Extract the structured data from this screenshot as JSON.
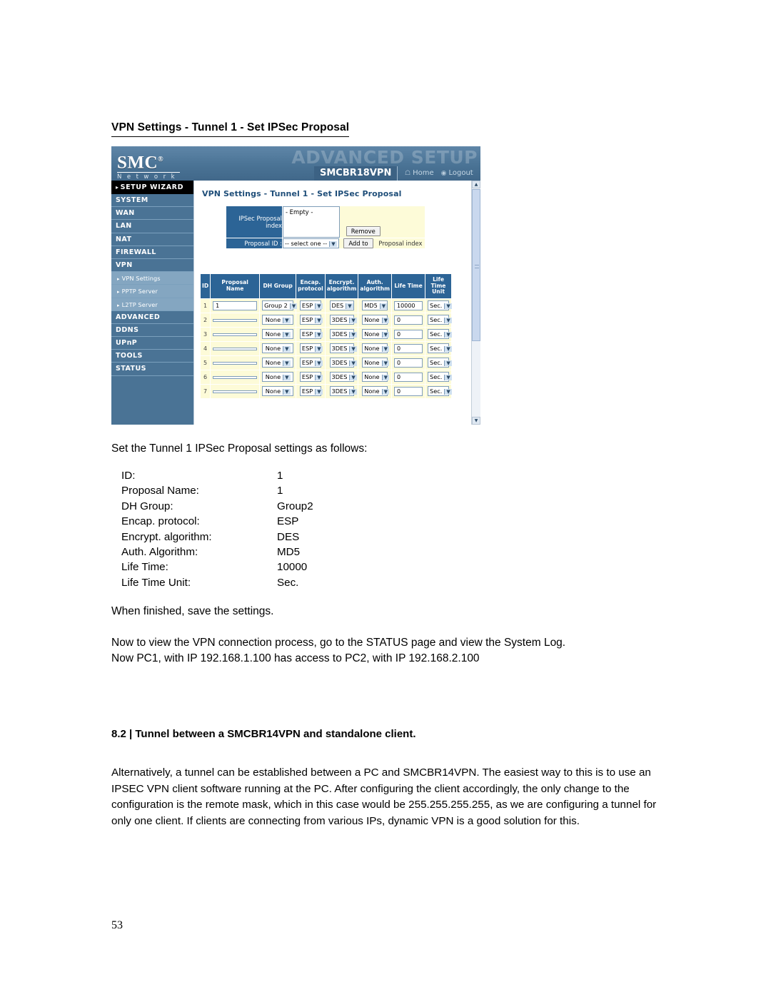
{
  "document": {
    "title": "VPN Settings - Tunnel 1 - Set IPSec Proposal",
    "intro": "Set the Tunnel 1 IPSec Proposal settings as follows:",
    "finish_note": "When finished, save the settings.",
    "status_note_line1": "Now to view the VPN connection process, go to the STATUS page and view the System Log.",
    "status_note_line2": "Now PC1, with IP 192.168.1.100 has access to PC2, with IP 192.168.2.100",
    "section_heading": "8.2 | Tunnel between a SMCBR14VPN and standalone client.",
    "section_paragraph": "Alternatively, a tunnel can be established between a PC and SMCBR14VPN. The easiest way to this is to use an IPSEC VPN client software running at the PC. After configuring the client accordingly, the only change to the configuration is the remote mask, which in this case would be 255.255.255.255, as we are configuring a tunnel for only one client. If clients are connecting from various IPs, dynamic VPN is a good solution for this.",
    "page_number": "53"
  },
  "settings_list": [
    {
      "key": "ID:",
      "value": "1"
    },
    {
      "key": "Proposal Name:",
      "value": "1"
    },
    {
      "key": "DH Group:",
      "value": "Group2"
    },
    {
      "key": "Encap. protocol:",
      "value": "ESP"
    },
    {
      "key": "Encrypt. algorithm:",
      "value": "DES"
    },
    {
      "key": "Auth. Algorithm:",
      "value": "MD5"
    },
    {
      "key": "Life Time:",
      "value": "10000"
    },
    {
      "key": "Life Time Unit:",
      "value": "Sec."
    }
  ],
  "router_ui": {
    "brand": "SMC",
    "brand_reg": "®",
    "brand_sub": "N e t w o r k s",
    "watermark": "ADVANCED SETUP",
    "model": "SMCBR18VPN",
    "top_nav": [
      {
        "label": "Home",
        "icon": "home-icon"
      },
      {
        "label": "Logout",
        "icon": "logout-icon"
      }
    ],
    "wizard_label": "SETUP WIZARD",
    "sidebar": [
      {
        "label": "SYSTEM",
        "type": "main"
      },
      {
        "label": "WAN",
        "type": "main"
      },
      {
        "label": "LAN",
        "type": "main"
      },
      {
        "label": "NAT",
        "type": "main"
      },
      {
        "label": "FIREWALL",
        "type": "main"
      },
      {
        "label": "VPN",
        "type": "main"
      },
      {
        "label": "VPN Settings",
        "type": "sub"
      },
      {
        "label": "PPTP Server",
        "type": "sub"
      },
      {
        "label": "L2TP Server",
        "type": "sub"
      },
      {
        "label": "ADVANCED",
        "type": "main"
      },
      {
        "label": "DDNS",
        "type": "main"
      },
      {
        "label": "UPnP",
        "type": "main"
      },
      {
        "label": "TOOLS",
        "type": "main"
      },
      {
        "label": "STATUS",
        "type": "main"
      }
    ],
    "pane_title": "VPN Settings - Tunnel 1 - Set IPSec Proposal",
    "form": {
      "index_label": "IPSec Proposal index",
      "index_value": "- Empty -",
      "remove_button": "Remove",
      "proposal_id_label": "Proposal ID :",
      "proposal_id_value": "-- select one --",
      "add_button": "Add to",
      "add_note": "Proposal index"
    },
    "table": {
      "headers": [
        "ID",
        "Proposal Name",
        "DH Group",
        "Encap. protocol",
        "Encrypt. algorithm",
        "Auth. algorithm",
        "Life Time",
        "Life Time Unit"
      ],
      "rows": [
        {
          "id": "1",
          "name": "1",
          "dh": "Group 2",
          "encap": "ESP",
          "encrypt": "DES",
          "auth": "MD5",
          "life": "10000",
          "unit": "Sec."
        },
        {
          "id": "2",
          "name": "",
          "dh": "None",
          "encap": "ESP",
          "encrypt": "3DES",
          "auth": "None",
          "life": "0",
          "unit": "Sec."
        },
        {
          "id": "3",
          "name": "",
          "dh": "None",
          "encap": "ESP",
          "encrypt": "3DES",
          "auth": "None",
          "life": "0",
          "unit": "Sec."
        },
        {
          "id": "4",
          "name": "",
          "dh": "None",
          "encap": "ESP",
          "encrypt": "3DES",
          "auth": "None",
          "life": "0",
          "unit": "Sec."
        },
        {
          "id": "5",
          "name": "",
          "dh": "None",
          "encap": "ESP",
          "encrypt": "3DES",
          "auth": "None",
          "life": "0",
          "unit": "Sec."
        },
        {
          "id": "6",
          "name": "",
          "dh": "None",
          "encap": "ESP",
          "encrypt": "3DES",
          "auth": "None",
          "life": "0",
          "unit": "Sec."
        },
        {
          "id": "7",
          "name": "",
          "dh": "None",
          "encap": "ESP",
          "encrypt": "3DES",
          "auth": "None",
          "life": "0",
          "unit": "Sec."
        }
      ]
    }
  },
  "colors": {
    "header_blue": "#4a7395",
    "table_header_blue": "#2c6496",
    "row_yellow": "#fdfbd8",
    "pane_title_blue": "#1f4e79"
  }
}
